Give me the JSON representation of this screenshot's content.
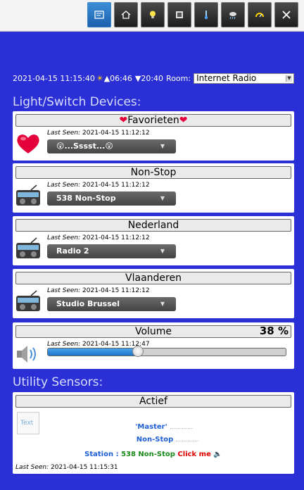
{
  "nav": {
    "buttons": [
      {
        "name": "dashboard-icon",
        "active": true
      },
      {
        "name": "house-icon",
        "active": false
      },
      {
        "name": "lightbulb-icon",
        "active": false
      },
      {
        "name": "film-icon",
        "active": false
      },
      {
        "name": "thermometer-icon",
        "active": false
      },
      {
        "name": "weather-icon",
        "active": false
      },
      {
        "name": "gauge-icon",
        "active": false
      },
      {
        "name": "tools-icon",
        "active": false
      }
    ]
  },
  "status": {
    "datetime": "2021-04-15 11:15:40",
    "sun_symbol": "☀",
    "sunrise": "▲06:46",
    "sunset": "▼20:40",
    "room_label": "Room:",
    "room_value": "Internet Radio"
  },
  "sections": {
    "devices_title": "Light/Switch Devices:",
    "utility_title": "Utility Sensors:"
  },
  "devices": [
    {
      "title_prefix": "❤",
      "title": "Favorieten",
      "title_suffix": "❤",
      "last_seen_label": "Last Seen:",
      "last_seen": "2021-04-15 11:12:12",
      "selected": "😲...Sssst...😲",
      "icon": "heart-icon"
    },
    {
      "title_prefix": "",
      "title": "Non-Stop",
      "title_suffix": "",
      "last_seen_label": "Last Seen:",
      "last_seen": "2021-04-15 11:12:12",
      "selected": "538 Non-Stop",
      "icon": "radio-icon"
    },
    {
      "title_prefix": "",
      "title": "Nederland",
      "title_suffix": "",
      "last_seen_label": "Last Seen:",
      "last_seen": "2021-04-15 11:12:12",
      "selected": "Radio 2",
      "icon": "radio-icon"
    },
    {
      "title_prefix": "",
      "title": "Vlaanderen",
      "title_suffix": "",
      "last_seen_label": "Last Seen:",
      "last_seen": "2021-04-15 11:12:12",
      "selected": "Studio Brussel",
      "icon": "radio-icon"
    }
  ],
  "volume": {
    "title": "Volume",
    "percent_label": "38 %",
    "level": 0.38,
    "last_seen_label": "Last Seen:",
    "last_seen": "2021-04-15 11:12:47"
  },
  "utility": {
    "title": "Actief",
    "icon_text": "Text",
    "master": "'Master'",
    "nonstop": "Non-Stop",
    "station_label": "Station :",
    "station_value": "538 Non-Stop",
    "click": "Click me",
    "last_seen_label": "Last Seen:",
    "last_seen": "2021-04-15 11:15:31"
  },
  "colors": {
    "background": "#2a2fd6",
    "accent_blue": "#1f73c6",
    "heart": "#e4003b",
    "station_green": "#1a8a1a",
    "click_red": "#e00000"
  }
}
